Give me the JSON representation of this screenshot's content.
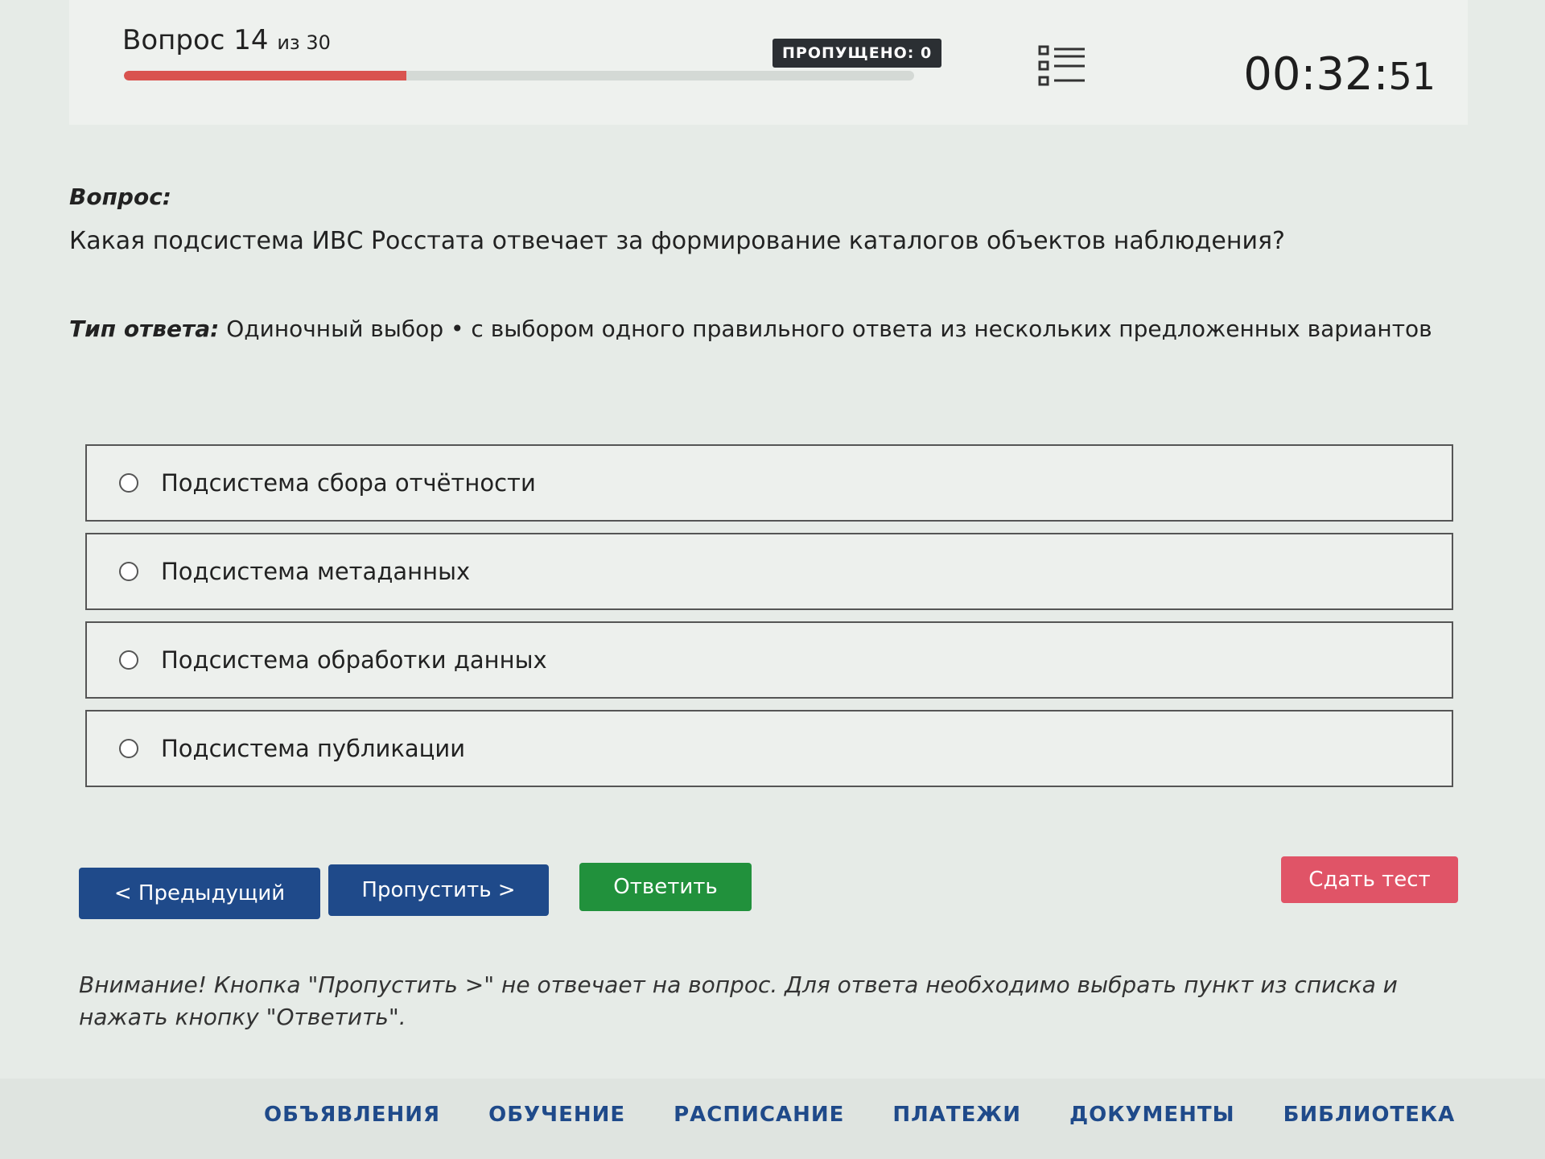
{
  "header": {
    "question_word": "Вопрос",
    "question_number": "14",
    "question_of": "из 30",
    "progress_fraction": 0.357,
    "skipped_label": "ПРОПУЩЕНО: 0",
    "timer_main": "00:32:",
    "timer_seconds": "51"
  },
  "question": {
    "label": "Вопрос:",
    "text": "Какая подсистема ИВС Росстата отвечает за формирование каталогов объектов наблюдения?"
  },
  "answer_type": {
    "label": "Тип ответа:",
    "value": "Одиночный выбор • с выбором одного правильного ответа из нескольких предложенных вариантов"
  },
  "options": [
    {
      "label": "Подсистема сбора отчётности"
    },
    {
      "label": "Подсистема метаданных"
    },
    {
      "label": "Подсистема обработки данных"
    },
    {
      "label": "Подсистема публикации"
    }
  ],
  "buttons": {
    "prev": "< Предыдущий",
    "skip": "Пропустить >",
    "answer": "Ответить",
    "submit": "Сдать тест"
  },
  "warning": "Внимание! Кнопка \"Пропустить >\" не отвечает на вопрос. Для ответа необходимо выбрать пункт из списка и нажать кнопку \"Ответить\".",
  "footer_nav": [
    "ОБЪЯВЛЕНИЯ",
    "ОБУЧЕНИЕ",
    "РАСПИСАНИЕ",
    "ПЛАТЕЖИ",
    "ДОКУМЕНТЫ",
    "БИБЛИОТЕКА"
  ],
  "icons": {
    "list": "list-icon"
  },
  "colors": {
    "progress": "#d9534f",
    "primary": "#1f4a8a",
    "answer": "#21913c",
    "submit": "#e05467"
  }
}
